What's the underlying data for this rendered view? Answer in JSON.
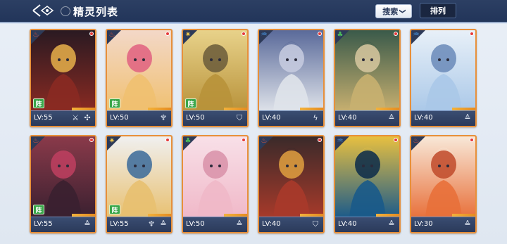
{
  "header": {
    "title": "精灵列表",
    "search_label": "搜索",
    "search_arrow": "❯",
    "sort_label": "排列",
    "back_glyph": "◁◇"
  },
  "cards": [
    {
      "level": "LV:55",
      "element": "fire",
      "element_glyph": "♨",
      "element_color": "#e8563a",
      "lineup": "阵",
      "jobs": [
        "⚔",
        "✣"
      ],
      "palette": [
        "#8a2a22",
        "#2a1a22",
        "#e8b04a"
      ]
    },
    {
      "level": "LV:50",
      "element": "fire",
      "element_glyph": "♨",
      "element_color": "#e8563a",
      "lineup": "阵",
      "jobs": [
        "♆"
      ],
      "palette": [
        "#f0c070",
        "#f3d8c8",
        "#e06080"
      ]
    },
    {
      "level": "LV:50",
      "element": "light",
      "element_glyph": "✷",
      "element_color": "#f0c64a",
      "lineup": "阵",
      "jobs": [
        "⛉"
      ],
      "palette": [
        "#b8923a",
        "#e8d28a",
        "#6a5a3a"
      ]
    },
    {
      "level": "LV:40",
      "element": "water",
      "element_glyph": "♒",
      "element_color": "#4a9ae8",
      "lineup": "",
      "jobs": [
        "ϟ"
      ],
      "palette": [
        "#dfe3ea",
        "#5a6a9a",
        "#c8cde0"
      ]
    },
    {
      "level": "LV:40",
      "element": "wind",
      "element_glyph": "♣",
      "element_color": "#4ab85a",
      "lineup": "",
      "jobs": [
        "≙"
      ],
      "palette": [
        "#c8b070",
        "#3a5a4a",
        "#d8c8a0"
      ]
    },
    {
      "level": "LV:40",
      "element": "water",
      "element_glyph": "♒",
      "element_color": "#4a9ae8",
      "lineup": "",
      "jobs": [
        "≙"
      ],
      "palette": [
        "#aac8e8",
        "#e8f0f8",
        "#6a8ab8"
      ]
    },
    {
      "level": "LV:55",
      "element": "fire",
      "element_glyph": "♨",
      "element_color": "#e8563a",
      "lineup": "阵",
      "jobs": [
        "≙"
      ],
      "palette": [
        "#3a2030",
        "#8a3a4a",
        "#c04060"
      ]
    },
    {
      "level": "LV:55",
      "element": "light",
      "element_glyph": "✷",
      "element_color": "#f0c64a",
      "lineup": "阵",
      "jobs": [
        "♆",
        "≙"
      ],
      "palette": [
        "#e8c070",
        "#f0f0f0",
        "#3a6a9a"
      ]
    },
    {
      "level": "LV:50",
      "element": "wind",
      "element_glyph": "♣",
      "element_color": "#4ab85a",
      "lineup": "",
      "jobs": [
        "≙"
      ],
      "palette": [
        "#f0b8c8",
        "#f8e0e8",
        "#d890a8"
      ]
    },
    {
      "level": "LV:40",
      "element": "fire",
      "element_glyph": "♨",
      "element_color": "#e8563a",
      "lineup": "",
      "jobs": [
        "⛉"
      ],
      "palette": [
        "#a83a2a",
        "#3a2a2a",
        "#e0a040"
      ]
    },
    {
      "level": "LV:40",
      "element": "water",
      "element_glyph": "♒",
      "element_color": "#4a9ae8",
      "lineup": "",
      "jobs": [
        "≙"
      ],
      "palette": [
        "#1a5a8a",
        "#e8c040",
        "#0a2a4a"
      ]
    },
    {
      "level": "LV:30",
      "element": "fire",
      "element_glyph": "♨",
      "element_color": "#e8563a",
      "lineup": "",
      "jobs": [
        "≙"
      ],
      "palette": [
        "#e8703a",
        "#f8e8d8",
        "#c04a2a"
      ]
    }
  ]
}
